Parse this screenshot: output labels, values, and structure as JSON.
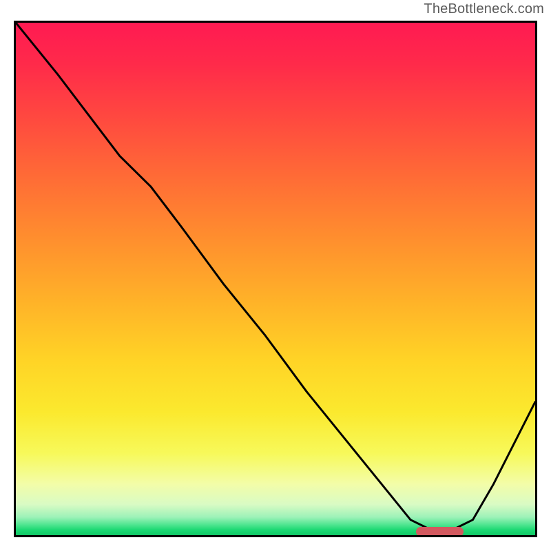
{
  "watermark": "TheBottleneck.com",
  "chart_data": {
    "type": "line",
    "title": "",
    "xlabel": "",
    "ylabel": "",
    "xlim": [
      0,
      100
    ],
    "ylim": [
      0,
      100
    ],
    "grid": false,
    "series": [
      {
        "name": "bottleneck-curve",
        "x": [
          0,
          8,
          14,
          20,
          26,
          32,
          40,
          48,
          56,
          64,
          72,
          76,
          80,
          84,
          88,
          92,
          96,
          100
        ],
        "values": [
          100,
          90,
          82,
          74,
          68,
          60,
          49,
          39,
          28,
          18,
          8,
          3,
          1,
          1,
          3,
          10,
          18,
          26
        ]
      }
    ],
    "gradient_stops": [
      {
        "pos": 0,
        "color": "#ff1a52"
      },
      {
        "pos": 0.18,
        "color": "#ff4740"
      },
      {
        "pos": 0.42,
        "color": "#ff8e2e"
      },
      {
        "pos": 0.66,
        "color": "#ffd426"
      },
      {
        "pos": 0.84,
        "color": "#f7f95a"
      },
      {
        "pos": 0.94,
        "color": "#d9fbc4"
      },
      {
        "pos": 1.0,
        "color": "#11c766"
      }
    ],
    "marker": {
      "color": "#d2595f",
      "x_center_pct": 81,
      "y_pct": 1.5,
      "width_pct": 9
    }
  }
}
